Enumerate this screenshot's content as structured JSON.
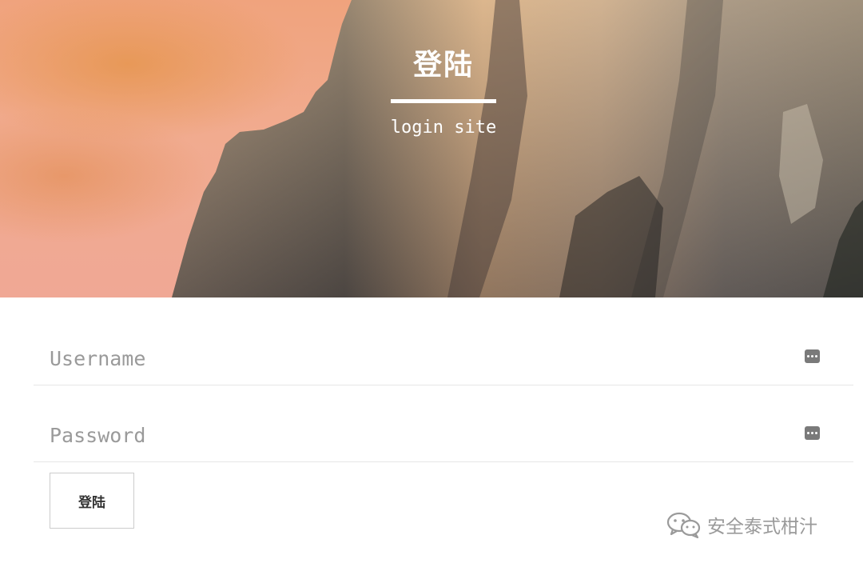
{
  "hero": {
    "title": "登陆",
    "subtitle": "login site"
  },
  "form": {
    "username": {
      "placeholder": "Username",
      "value": "",
      "icon": "password-manager-key-icon"
    },
    "password": {
      "placeholder": "Password",
      "value": "",
      "icon": "password-manager-key-icon"
    },
    "submit_label": "登陆"
  },
  "watermark": {
    "icon": "wechat-icon",
    "text": "安全泰式柑汁"
  },
  "colors": {
    "sky": "#f0a895",
    "rock": "#7d746c",
    "text_on_hero": "#ffffff",
    "placeholder": "#9a9a9a",
    "divider": "#e6e6e6"
  }
}
